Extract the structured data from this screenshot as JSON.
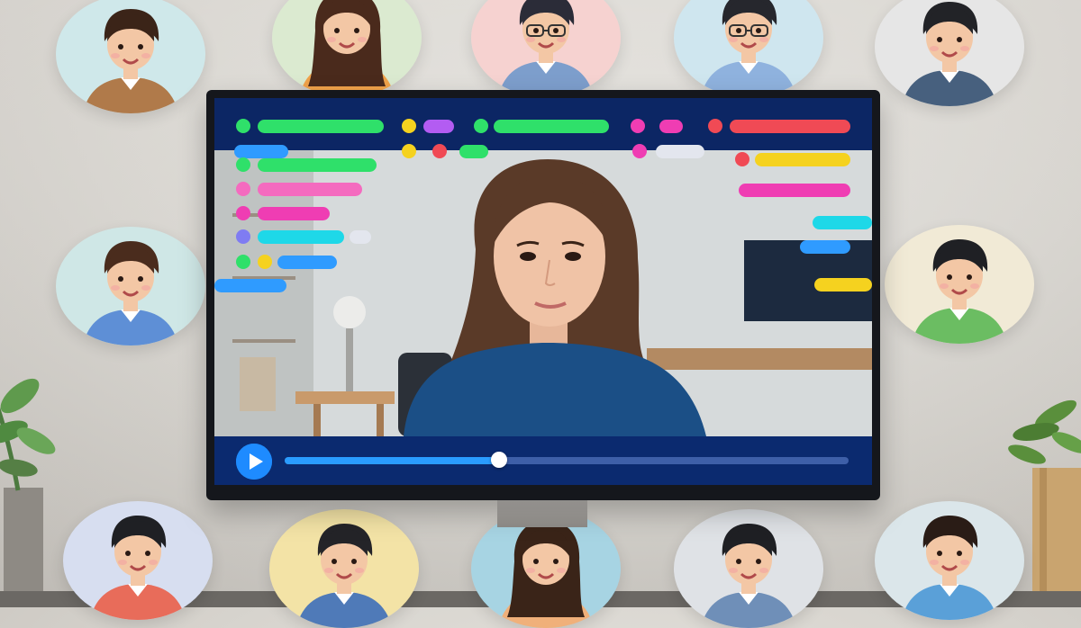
{
  "colors": {
    "green": "#2fe06a",
    "yellow": "#f5d21f",
    "purple": "#b35cf2",
    "magenta": "#ef3db3",
    "pink": "#f46bbf",
    "red": "#f04a55",
    "cyan": "#1ed8e8",
    "blue": "#2f9bff",
    "light": "#e3e6ee",
    "lavender": "#7f7cf2",
    "accent": "#1e8bff"
  },
  "player": {
    "play_icon": "play-icon",
    "progress": 0.38
  },
  "avatars": [
    {
      "name": "avatar-man-brown-jacket",
      "bg": "#cfe8ea",
      "shirt": "#b07a4a",
      "hair": "#3b2418",
      "hair_style": "short"
    },
    {
      "name": "avatar-woman-orange-top",
      "bg": "#dbead0",
      "shirt": "#f0a24a",
      "hair": "#4a2a1c",
      "hair_style": "long"
    },
    {
      "name": "avatar-man-glasses-blue",
      "bg": "#f6d2d0",
      "shirt": "#7d9ecc",
      "hair": "#2b2c38",
      "hair_style": "glasses"
    },
    {
      "name": "avatar-man-glasses-light",
      "bg": "#cfe6ef",
      "shirt": "#8fb2de",
      "hair": "#26272d",
      "hair_style": "glasses"
    },
    {
      "name": "avatar-man-navy-shirt",
      "bg": "#e6e6e6",
      "shirt": "#47607e",
      "hair": "#222327",
      "hair_style": "short"
    },
    {
      "name": "avatar-man-blue-shirt",
      "bg": "#cfe7e6",
      "shirt": "#5e8fd6",
      "hair": "#4a2c1d",
      "hair_style": "short"
    },
    {
      "name": "avatar-man-green-shirt",
      "bg": "#f1ead6",
      "shirt": "#6bbd62",
      "hair": "#1f2024",
      "hair_style": "short"
    },
    {
      "name": "avatar-man-bottom-1",
      "bg": "#d7def0",
      "shirt": "#e86c5a",
      "hair": "#1f2024",
      "hair_style": "short"
    },
    {
      "name": "avatar-man-bottom-2",
      "bg": "#f3e3a6",
      "shirt": "#4f7ab8",
      "hair": "#242428",
      "hair_style": "short"
    },
    {
      "name": "avatar-woman-bottom",
      "bg": "#a7d4e3",
      "shirt": "#f0b07a",
      "hair": "#3a2418",
      "hair_style": "long"
    },
    {
      "name": "avatar-man-bottom-3",
      "bg": "#dfe2e6",
      "shirt": "#6f8fb8",
      "hair": "#1f2024",
      "hair_style": "short"
    },
    {
      "name": "avatar-man-bottom-4",
      "bg": "#dbe6ea",
      "shirt": "#5aa0d8",
      "hair": "#2a1c16",
      "hair_style": "short"
    }
  ]
}
